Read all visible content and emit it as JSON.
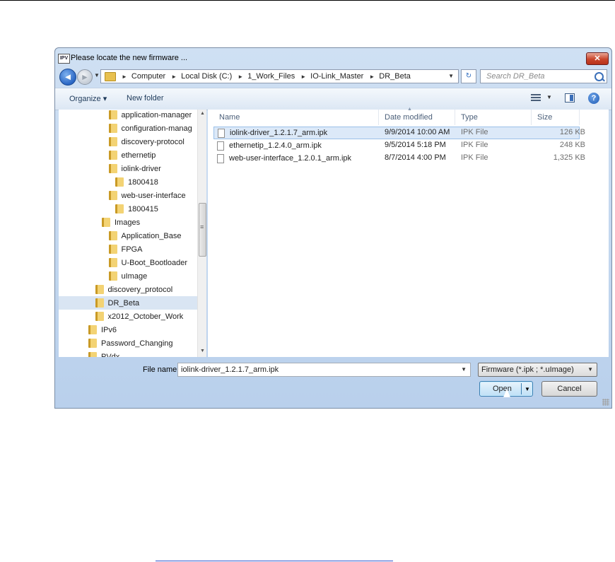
{
  "window": {
    "app_icon": "IPV",
    "title": "Please locate the new firmware ...",
    "close_label": "✕"
  },
  "navigation": {
    "back_icon": "back-arrow-icon",
    "forward_icon": "forward-arrow-icon",
    "breadcrumbs": [
      "Computer",
      "Local Disk (C:)",
      "1_Work_Files",
      "IO-Link_Master",
      "DR_Beta"
    ],
    "search_placeholder": "Search DR_Beta"
  },
  "toolbar": {
    "organize_label": "Organize ▾",
    "new_folder_label": "New folder"
  },
  "tree": [
    {
      "label": "application-manager",
      "level": 3
    },
    {
      "label": "configuration-manag",
      "level": 3
    },
    {
      "label": "discovery-protocol",
      "level": 3
    },
    {
      "label": "ethernetip",
      "level": 3
    },
    {
      "label": "iolink-driver",
      "level": 3
    },
    {
      "label": "1800418",
      "level": 4
    },
    {
      "label": "web-user-interface",
      "level": 3
    },
    {
      "label": "1800415",
      "level": 4
    },
    {
      "label": "Images",
      "level": 2
    },
    {
      "label": "Application_Base",
      "level": 3
    },
    {
      "label": "FPGA",
      "level": 3
    },
    {
      "label": "U-Boot_Bootloader",
      "level": 3
    },
    {
      "label": "uImage",
      "level": 3
    },
    {
      "label": "discovery_protocol",
      "level": 1
    },
    {
      "label": "DR_Beta",
      "level": 1,
      "selected": true
    },
    {
      "label": "x2012_October_Work",
      "level": 1
    },
    {
      "label": "IPv6",
      "level": 0
    },
    {
      "label": "Password_Changing",
      "level": 0
    },
    {
      "label": "PVdx",
      "level": 0
    }
  ],
  "file_list": {
    "columns": [
      "Name",
      "Date modified",
      "Type",
      "Size"
    ],
    "rows": [
      {
        "name": "iolink-driver_1.2.1.7_arm.ipk",
        "date": "9/9/2014 10:00 AM",
        "type": "IPK File",
        "size": "126 KB",
        "selected": true
      },
      {
        "name": "ethernetip_1.2.4.0_arm.ipk",
        "date": "9/5/2014 5:18 PM",
        "type": "IPK File",
        "size": "248 KB"
      },
      {
        "name": "web-user-interface_1.2.0.1_arm.ipk",
        "date": "8/7/2014 4:00 PM",
        "type": "IPK File",
        "size": "1,325 KB"
      }
    ]
  },
  "footer": {
    "file_name_label": "File name:",
    "file_name_value": "iolink-driver_1.2.1.7_arm.ipk",
    "filter_value": "Firmware (*.ipk ; *.uImage)",
    "open_label": "Open",
    "cancel_label": "Cancel"
  },
  "colors": {
    "selection": "#dce9f8",
    "window_frame": "#b9d0ec",
    "close_button": "#c9452b"
  }
}
